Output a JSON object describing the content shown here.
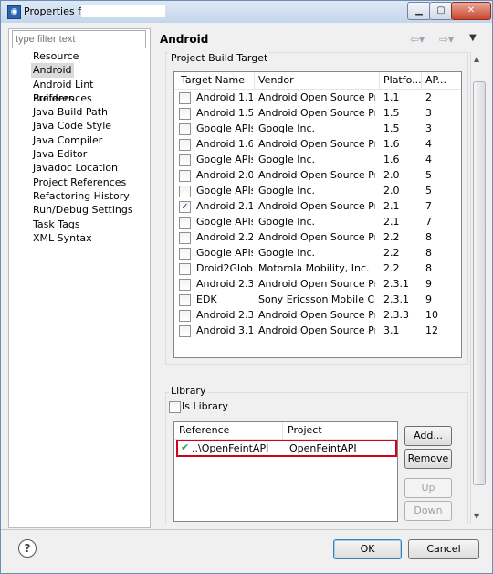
{
  "window": {
    "title": "Properties for"
  },
  "left": {
    "filter_placeholder": "type filter text",
    "items": [
      {
        "label": "Resource"
      },
      {
        "label": "Android",
        "selected": true
      },
      {
        "label": "Android Lint Preferences"
      },
      {
        "label": "Builders"
      },
      {
        "label": "Java Build Path"
      },
      {
        "label": "Java Code Style"
      },
      {
        "label": "Java Compiler"
      },
      {
        "label": "Java Editor"
      },
      {
        "label": "Javadoc Location"
      },
      {
        "label": "Project References"
      },
      {
        "label": "Refactoring History"
      },
      {
        "label": "Run/Debug Settings"
      },
      {
        "label": "Task Tags"
      },
      {
        "label": "XML Syntax"
      }
    ]
  },
  "page": {
    "title": "Android",
    "build_target": {
      "group_label": "Project Build Target",
      "columns": [
        "Target Name",
        "Vendor",
        "Platfo...",
        "AP..."
      ],
      "rows": [
        {
          "name": "Android 1.1",
          "vendor": "Android Open Source Proj...",
          "platform": "1.1",
          "api": "2",
          "checked": false
        },
        {
          "name": "Android 1.5",
          "vendor": "Android Open Source Proj...",
          "platform": "1.5",
          "api": "3",
          "checked": false
        },
        {
          "name": "Google APIs",
          "vendor": "Google Inc.",
          "platform": "1.5",
          "api": "3",
          "checked": false
        },
        {
          "name": "Android 1.6",
          "vendor": "Android Open Source Proj...",
          "platform": "1.6",
          "api": "4",
          "checked": false
        },
        {
          "name": "Google APIs",
          "vendor": "Google Inc.",
          "platform": "1.6",
          "api": "4",
          "checked": false
        },
        {
          "name": "Android 2.0",
          "vendor": "Android Open Source Proj...",
          "platform": "2.0",
          "api": "5",
          "checked": false
        },
        {
          "name": "Google APIs",
          "vendor": "Google Inc.",
          "platform": "2.0",
          "api": "5",
          "checked": false
        },
        {
          "name": "Android 2.1",
          "vendor": "Android Open Source Proj...",
          "platform": "2.1",
          "api": "7",
          "checked": true
        },
        {
          "name": "Google APIs",
          "vendor": "Google Inc.",
          "platform": "2.1",
          "api": "7",
          "checked": false
        },
        {
          "name": "Android 2.2",
          "vendor": "Android Open Source Proj...",
          "platform": "2.2",
          "api": "8",
          "checked": false
        },
        {
          "name": "Google APIs",
          "vendor": "Google Inc.",
          "platform": "2.2",
          "api": "8",
          "checked": false
        },
        {
          "name": "Droid2Global",
          "vendor": "Motorola Mobility, Inc.",
          "platform": "2.2",
          "api": "8",
          "checked": false
        },
        {
          "name": "Android 2.3.1",
          "vendor": "Android Open Source Proj...",
          "platform": "2.3.1",
          "api": "9",
          "checked": false
        },
        {
          "name": "EDK",
          "vendor": "Sony Ericsson Mobile Co...",
          "platform": "2.3.1",
          "api": "9",
          "checked": false
        },
        {
          "name": "Android 2.3.3",
          "vendor": "Android Open Source Proj...",
          "platform": "2.3.3",
          "api": "10",
          "checked": false
        },
        {
          "name": "Android 3.1",
          "vendor": "Android Open Source Proj...",
          "platform": "3.1",
          "api": "12",
          "checked": false
        }
      ]
    },
    "library": {
      "group_label": "Library",
      "is_library_label": "Is Library",
      "is_library_checked": false,
      "columns": [
        "Reference",
        "Project"
      ],
      "rows": [
        {
          "reference": "..\\OpenFeintAPI",
          "project": "OpenFeintAPI"
        }
      ],
      "buttons": {
        "add": "Add...",
        "remove": "Remove",
        "up": "Up",
        "down": "Down"
      }
    }
  },
  "footer": {
    "ok": "OK",
    "cancel": "Cancel"
  },
  "colors": {
    "highlight_border": "#d0021b",
    "check_green": "#2ea44f"
  }
}
